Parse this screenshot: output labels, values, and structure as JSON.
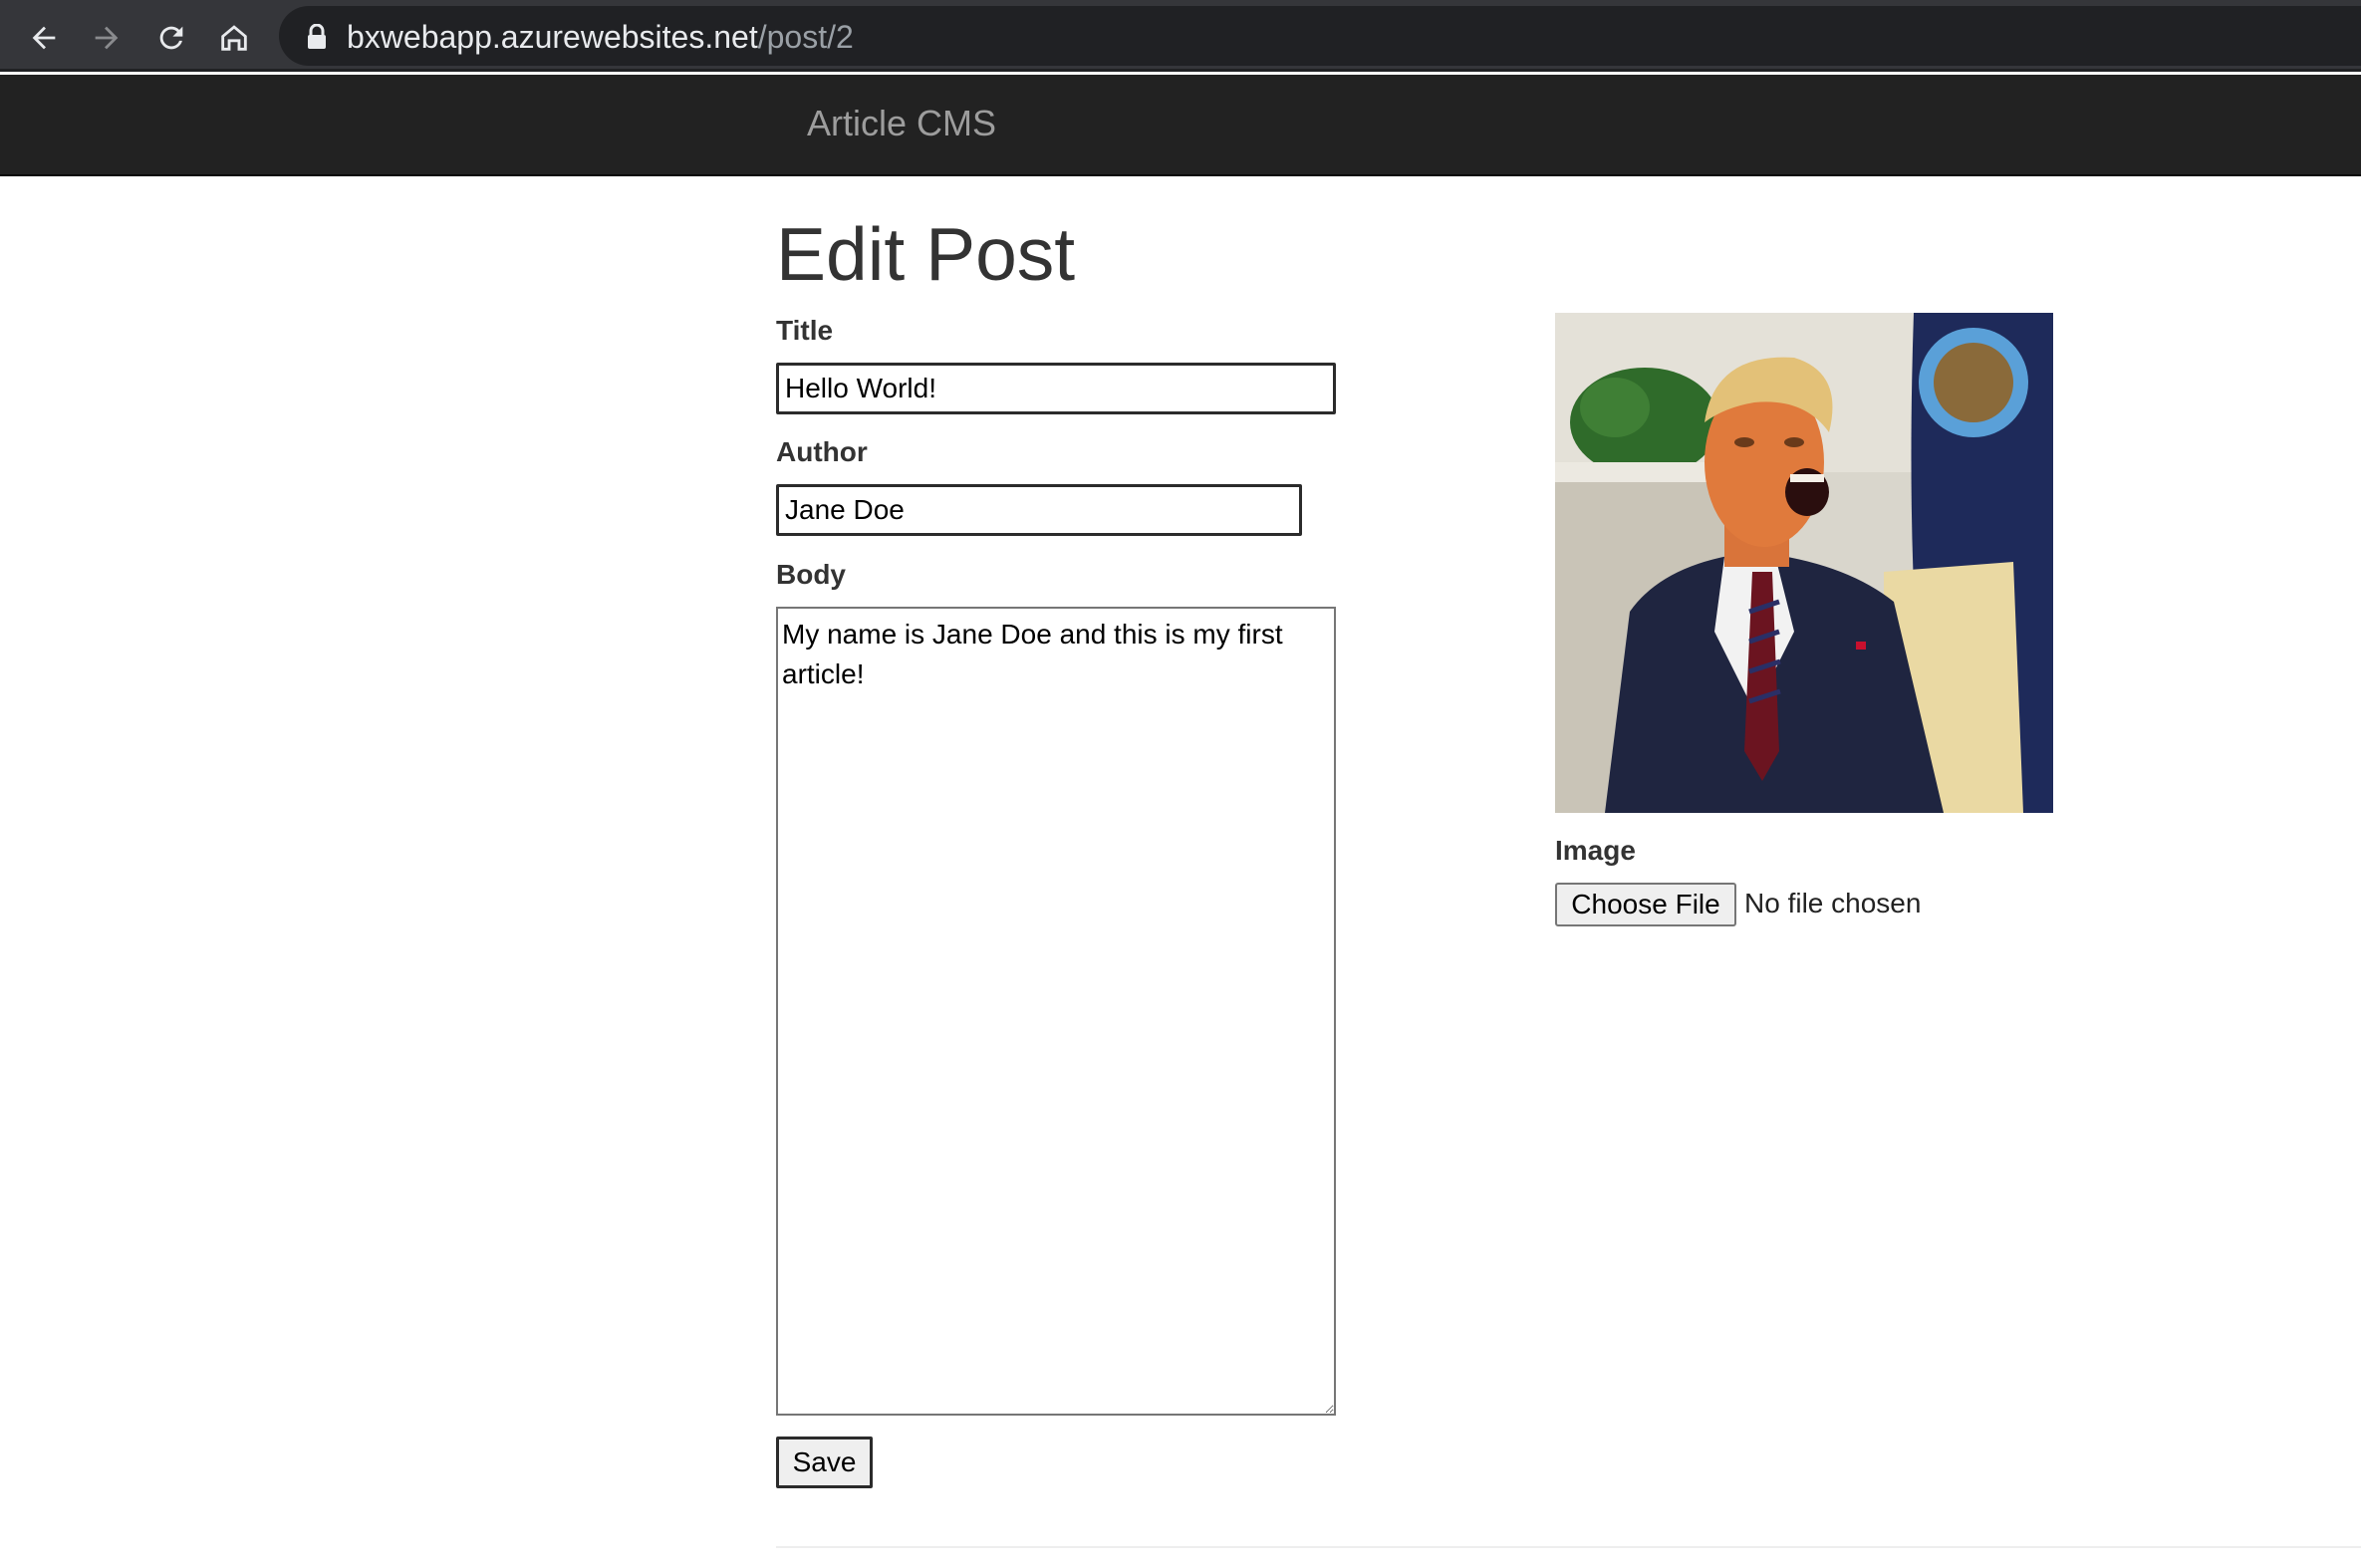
{
  "browser": {
    "url_host": "bxwebapp.azurewebsites.net",
    "url_path": "/post/2"
  },
  "navbar": {
    "brand": "Article CMS"
  },
  "form": {
    "heading": "Edit Post",
    "title_label": "Title",
    "title_value": "Hello World!",
    "author_label": "Author",
    "author_value": "Jane Doe",
    "body_label": "Body",
    "body_value": "My name is Jane Doe and this is my first article!",
    "save_label": "Save"
  },
  "image_panel": {
    "image_label": "Image",
    "choose_file_label": "Choose File",
    "file_status": "No file chosen"
  },
  "colors": {
    "navbar_bg": "#222222",
    "brand_text": "#9d9d9d",
    "browser_bg": "#35363a"
  }
}
